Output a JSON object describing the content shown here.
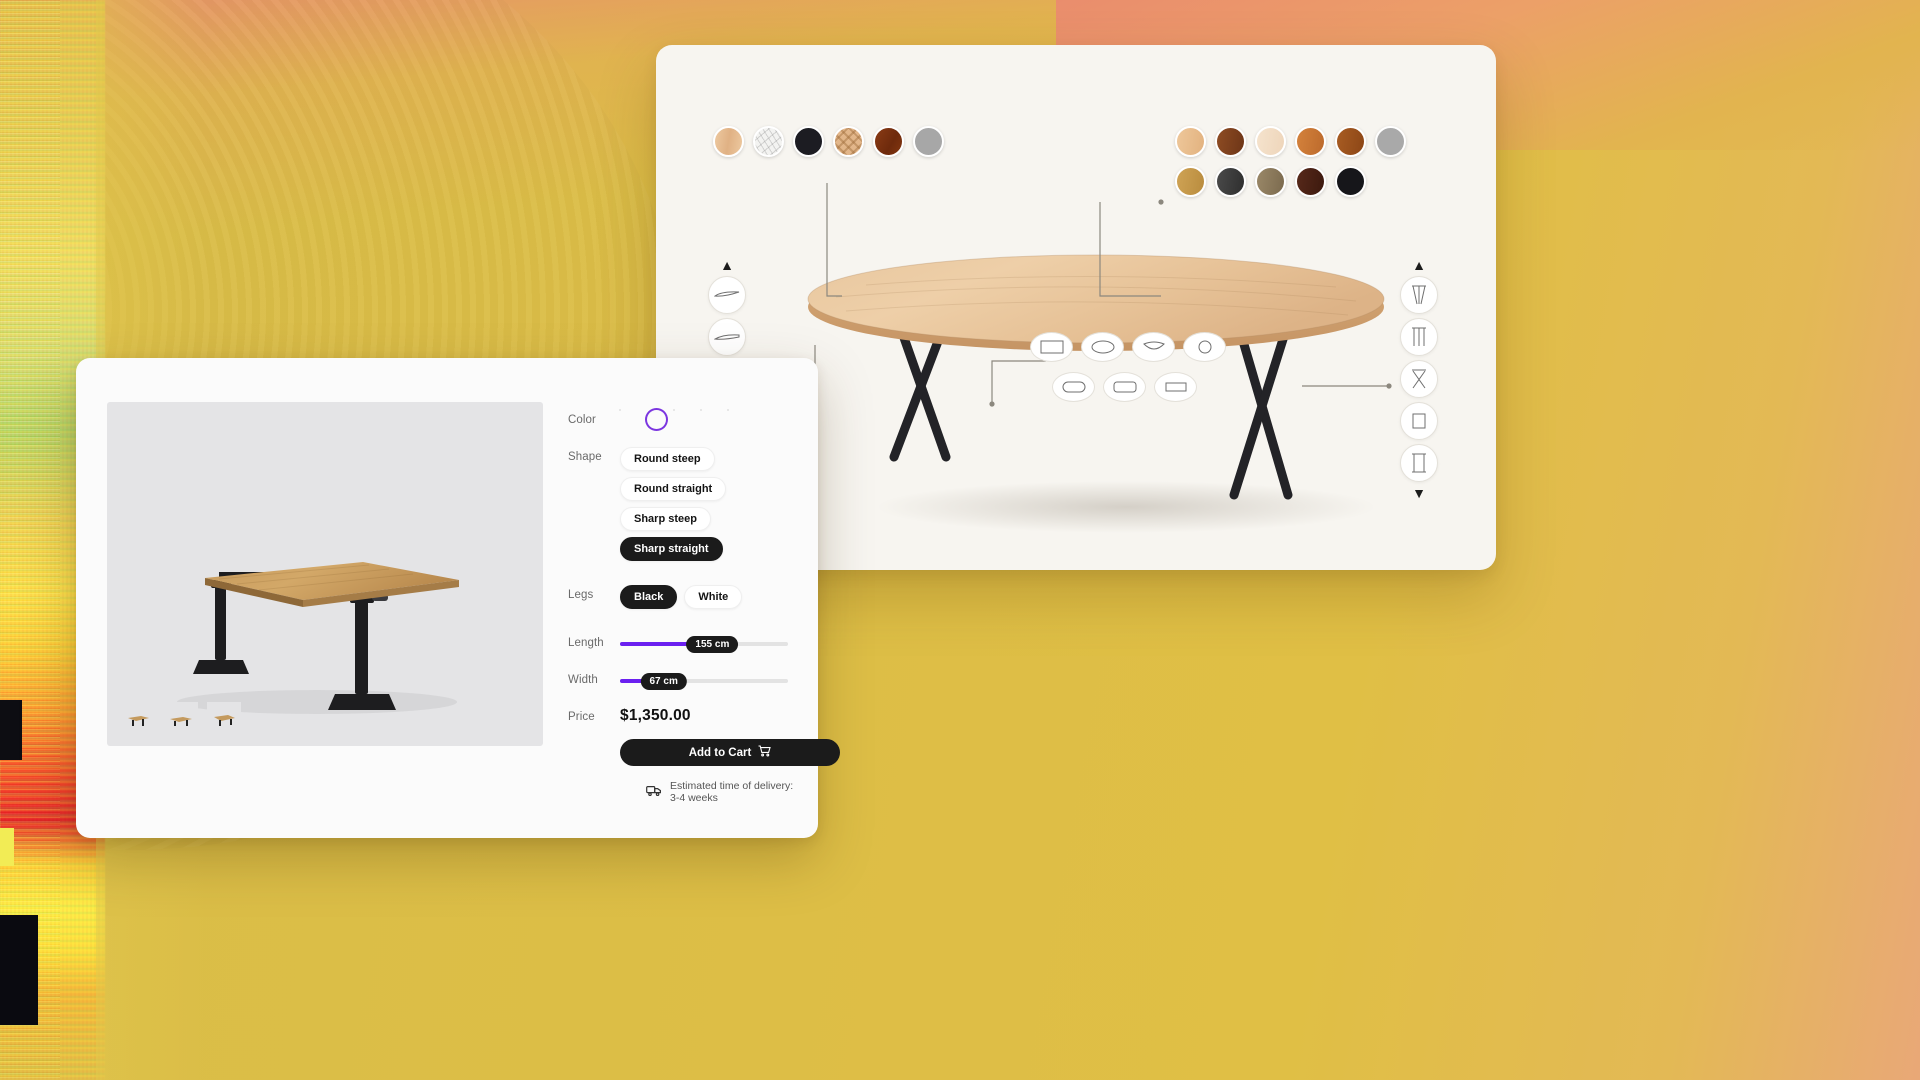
{
  "background": {
    "base_color": "#ddbe46",
    "accent_color": "#ea8d6d"
  },
  "back_panel": {
    "name": "table-configurator-panel",
    "top_material_swatches": [
      {
        "name": "light-oak",
        "color": "#e8c39a"
      },
      {
        "name": "white-marble",
        "color": "#eeeeec"
      },
      {
        "name": "black",
        "color": "#1c1c22"
      },
      {
        "name": "herringbone-oak",
        "color": "#dfb07c"
      },
      {
        "name": "dark-walnut",
        "color": "#7c3111"
      },
      {
        "name": "grey",
        "color": "#a7a7a7"
      }
    ],
    "leg_material_swatches": [
      {
        "name": "natural-oak",
        "color": "#e6bd8e"
      },
      {
        "name": "walnut",
        "color": "#8a4a22"
      },
      {
        "name": "cream-oak",
        "color": "#f0dcc4"
      },
      {
        "name": "amber-oak",
        "color": "#c9793a"
      },
      {
        "name": "chestnut",
        "color": "#a0561f"
      },
      {
        "name": "grey-oak",
        "color": "#a7a7a7"
      },
      {
        "name": "honey-oak",
        "color": "#c89a4c"
      },
      {
        "name": "charcoal",
        "color": "#3b3b3b"
      },
      {
        "name": "smoke-oak",
        "color": "#8c7a5e"
      },
      {
        "name": "espresso",
        "color": "#4a2214"
      },
      {
        "name": "jet-black",
        "color": "#16161a"
      }
    ],
    "edge_options_count": 3,
    "leg_options_count": 5,
    "tabletop_shape_options_count": 7,
    "caret_up": "▲",
    "caret_down": "▼"
  },
  "front_panel": {
    "name": "desk-product-configurator",
    "color": {
      "label": "Color",
      "swatches": [
        {
          "name": "black",
          "color": "#2c2c2c",
          "selected": false
        },
        {
          "name": "light-oak",
          "color": "#c99a5e",
          "selected": true
        },
        {
          "name": "natural-oak",
          "color": "#e5bd84",
          "selected": false
        },
        {
          "name": "walnut",
          "color": "#6b3b24",
          "selected": false
        },
        {
          "name": "dark-walnut",
          "color": "#7a4830",
          "selected": false
        }
      ]
    },
    "shape": {
      "label": "Shape",
      "options": [
        {
          "label": "Round steep",
          "selected": false
        },
        {
          "label": "Round straight",
          "selected": false
        },
        {
          "label": "Sharp steep",
          "selected": false
        },
        {
          "label": "Sharp straight",
          "selected": true
        }
      ]
    },
    "legs": {
      "label": "Legs",
      "options": [
        {
          "label": "Black",
          "selected": true
        },
        {
          "label": "White",
          "selected": false
        }
      ]
    },
    "length": {
      "label": "Length",
      "value": "155 cm",
      "percent": 55
    },
    "width": {
      "label": "Width",
      "value": "67 cm",
      "percent": 26
    },
    "price": {
      "label": "Price",
      "value": "$1,350.00"
    },
    "add_to_cart": {
      "label": "Add to Cart",
      "icon": "shopping-cart-icon"
    },
    "delivery": {
      "icon": "delivery-truck-icon",
      "text": "Estimated time of delivery: 3-4 weeks"
    },
    "thumbnails_count": 3
  }
}
